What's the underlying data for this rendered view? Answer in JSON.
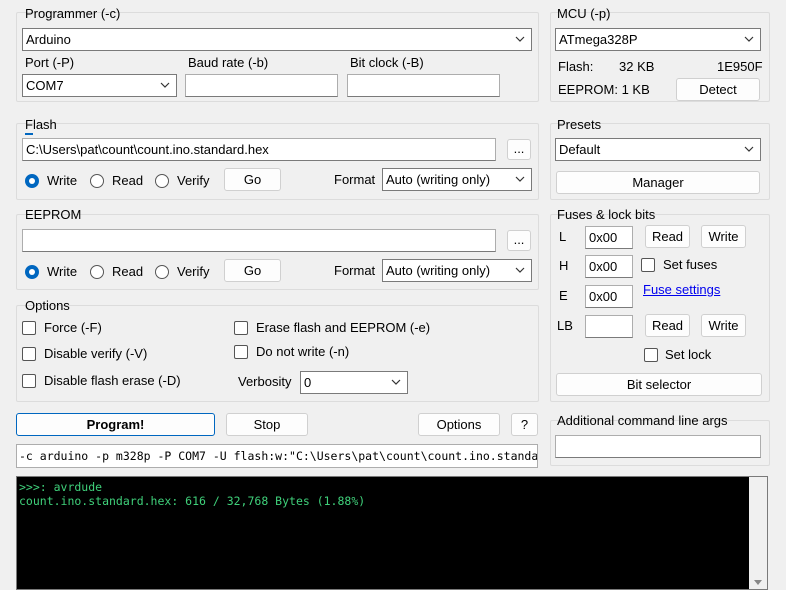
{
  "programmer": {
    "group_title": "Programmer (-c)",
    "selected": "Arduino",
    "port_label": "Port (-P)",
    "port_value": "COM7",
    "baud_label": "Baud rate (-b)",
    "baud_value": "",
    "bitclock_label": "Bit clock (-B)",
    "bitclock_value": ""
  },
  "mcu": {
    "group_title": "MCU (-p)",
    "selected": "ATmega328P",
    "flash_label": "Flash:",
    "flash_size": "32 KB",
    "signature": "1E950F",
    "eeprom_label": "EEPROM: 1 KB",
    "detect_button": "Detect"
  },
  "flash": {
    "group_title": "Flash",
    "path": "C:\\Users\\pat\\count\\count.ino.standard.hex",
    "browse_button": "...",
    "write_label": "Write",
    "read_label": "Read",
    "verify_label": "Verify",
    "selected_mode": "write",
    "go_button": "Go",
    "format_label": "Format",
    "format_value": "Auto (writing only)"
  },
  "eeprom": {
    "group_title": "EEPROM",
    "path": "",
    "browse_button": "...",
    "write_label": "Write",
    "read_label": "Read",
    "verify_label": "Verify",
    "selected_mode": "write",
    "go_button": "Go",
    "format_label": "Format",
    "format_value": "Auto (writing only)"
  },
  "presets": {
    "group_title": "Presets",
    "selected": "Default",
    "manager_button": "Manager"
  },
  "fuses": {
    "group_title": "Fuses & lock bits",
    "l_label": "L",
    "l_value": "0x00",
    "h_label": "H",
    "h_value": "0x00",
    "e_label": "E",
    "e_value": "0x00",
    "lb_label": "LB",
    "lb_value": "",
    "read_button": "Read",
    "write_button": "Write",
    "set_fuses_label": "Set fuses",
    "fuse_settings_link": "Fuse settings",
    "set_lock_label": "Set lock",
    "bit_selector_button": "Bit selector"
  },
  "options": {
    "group_title": "Options",
    "force_label": "Force (-F)",
    "disable_verify_label": "Disable verify (-V)",
    "disable_flash_erase_label": "Disable flash erase (-D)",
    "erase_flash_eeprom_label": "Erase flash and EEPROM (-e)",
    "do_not_write_label": "Do not write (-n)",
    "verbosity_label": "Verbosity",
    "verbosity_value": "0"
  },
  "actions": {
    "program_button": "Program!",
    "stop_button": "Stop",
    "options_button": "Options",
    "help_button": "?"
  },
  "additional_args": {
    "label": "Additional command line args",
    "value": ""
  },
  "command_line": "-c arduino -p m328p -P COM7 -U flash:w:\"C:\\Users\\pat\\count\\count.ino.standa",
  "console": {
    "lines": [
      ">>>: avrdude",
      "count.ino.standard.hex: 616 / 32,768 Bytes (1.88%)"
    ]
  },
  "colors": {
    "accent": "#0067c0",
    "console_bg": "#000000",
    "console_text": "#3fd07a",
    "window_bg": "#f0f0f0"
  }
}
